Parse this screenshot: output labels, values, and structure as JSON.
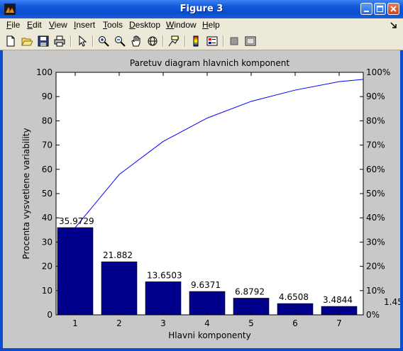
{
  "window": {
    "title": "Figure 3"
  },
  "menu": {
    "items": [
      "File",
      "Edit",
      "View",
      "Insert",
      "Tools",
      "Desktop",
      "Window",
      "Help"
    ]
  },
  "toolbar": {
    "buttons": [
      "new-figure-icon",
      "open-file-icon",
      "save-icon",
      "print-icon",
      "edit-plot-arrow-icon",
      "zoom-in-icon",
      "zoom-out-icon",
      "pan-hand-icon",
      "rotate-3d-icon",
      "data-cursor-icon",
      "insert-colorbar-icon",
      "insert-legend-icon",
      "hide-plot-tools-icon",
      "show-plot-tools-icon"
    ]
  },
  "chart_data": {
    "type": "bar",
    "title": "Paretuv diagram hlavnich komponent",
    "xlabel": "Hlavni komponenty",
    "ylabel": "Procenta vysvetlene variability",
    "categories": [
      "1",
      "2",
      "3",
      "4",
      "5",
      "6",
      "7"
    ],
    "values": [
      35.9729,
      21.882,
      13.6503,
      9.6371,
      6.8792,
      4.6508,
      3.4844
    ],
    "value_labels": [
      "35.9729",
      "21.882",
      "13.6503",
      "9.6371",
      "6.8792",
      "4.6508",
      "3.4844"
    ],
    "overflow_label": "1.45",
    "ylim": [
      0,
      100
    ],
    "yticks": [
      "0",
      "10",
      "20",
      "30",
      "40",
      "50",
      "60",
      "70",
      "80",
      "90",
      "100"
    ],
    "y2ticks": [
      "0%",
      "10%",
      "20%",
      "30%",
      "40%",
      "50%",
      "60%",
      "70%",
      "80%",
      "90%",
      "100%"
    ],
    "cumulative_line": [
      35.9729,
      57.8549,
      71.5052,
      81.1423,
      88.0215,
      92.6723,
      96.1567
    ],
    "bar_color": "#00008b",
    "line_color": "#0000ff",
    "grid": false
  }
}
